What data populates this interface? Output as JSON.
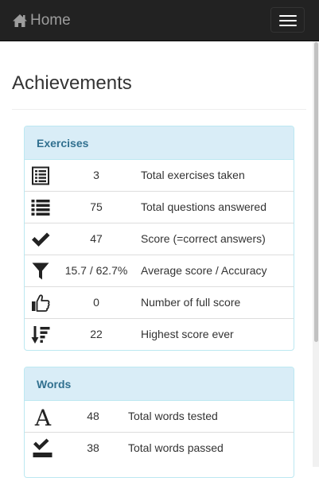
{
  "navbar": {
    "brand_label": "Home",
    "home_icon": "home-icon",
    "menu_icon": "hamburger-menu-icon"
  },
  "page": {
    "title": "Achievements"
  },
  "exercises": {
    "heading": "Exercises",
    "rows": [
      {
        "icon": "list-alt-icon",
        "value": "3",
        "label": "Total exercises taken"
      },
      {
        "icon": "list-icon",
        "value": "75",
        "label": "Total questions answered"
      },
      {
        "icon": "checkmark-icon",
        "value": "47",
        "label": "Score (=correct answers)"
      },
      {
        "icon": "filter-icon",
        "value": "15.7 / 62.7%",
        "label": "Average score / Accuracy"
      },
      {
        "icon": "thumbs-up-icon",
        "value": "0",
        "label": "Number of full score"
      },
      {
        "icon": "sort-descending-icon",
        "value": "22",
        "label": "Highest score ever"
      }
    ]
  },
  "words": {
    "heading": "Words",
    "rows": [
      {
        "icon": "font-icon",
        "value": "48",
        "label": "Total words tested"
      },
      {
        "icon": "check-box-icon",
        "value": "38",
        "label": "Total words passed"
      }
    ]
  },
  "colors": {
    "navbar_bg": "#222222",
    "panel_heading_bg": "#d9edf7",
    "panel_heading_text": "#31708f",
    "panel_border": "#bce8f1"
  }
}
